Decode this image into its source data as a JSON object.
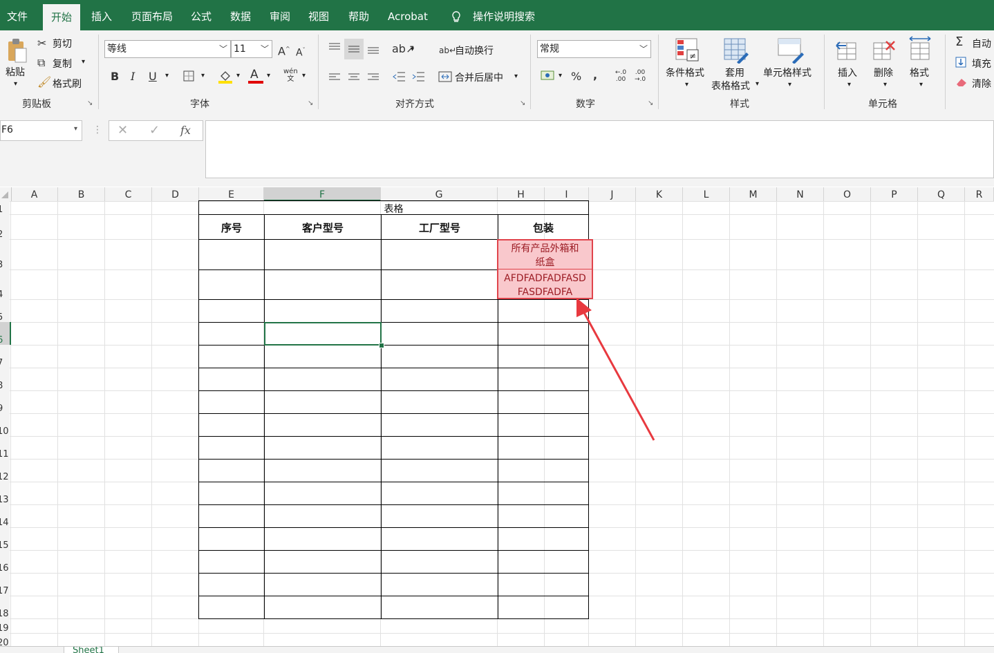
{
  "menu": {
    "tabs": [
      "文件",
      "开始",
      "插入",
      "页面布局",
      "公式",
      "数据",
      "审阅",
      "视图",
      "帮助",
      "Acrobat"
    ],
    "search_label": "操作说明搜索"
  },
  "ribbon": {
    "clipboard": {
      "paste": "粘贴",
      "cut": "剪切",
      "copy": "复制",
      "format_painter": "格式刷",
      "label": "剪贴板"
    },
    "font": {
      "name": "等线",
      "size": "11",
      "bold": "B",
      "italic": "I",
      "underline": "U",
      "label": "字体"
    },
    "alignment": {
      "wrap_text": "自动换行",
      "merge_center": "合并后居中",
      "label": "对齐方式"
    },
    "number": {
      "format": "常规",
      "percent": "%",
      "comma": ",",
      "label": "数字"
    },
    "styles": {
      "conditional": "条件格式",
      "table_format_1": "套用",
      "table_format_2": "表格格式",
      "cell_styles": "单元格样式",
      "label": "样式"
    },
    "cells": {
      "insert": "插入",
      "delete": "删除",
      "format": "格式",
      "label": "单元格"
    },
    "editing": {
      "autosum": "自动",
      "fill": "填充",
      "clear": "清除"
    }
  },
  "formula_bar": {
    "name_box": "F6",
    "fx": "fx",
    "content": ""
  },
  "grid": {
    "columns": [
      "A",
      "B",
      "C",
      "D",
      "E",
      "F",
      "G",
      "H",
      "I",
      "J",
      "K",
      "L",
      "M",
      "N",
      "O",
      "P",
      "Q",
      "R"
    ],
    "rows": [
      "1",
      "2",
      "3",
      "4",
      "5",
      "6",
      "7",
      "8",
      "9",
      "10",
      "11",
      "12",
      "13",
      "14",
      "15",
      "16",
      "17",
      "18",
      "19",
      "20"
    ]
  },
  "table": {
    "title": "表格",
    "headers": [
      "序号",
      "客户型号",
      "工厂型号",
      "包装"
    ],
    "h3_line1": "所有产品外箱和",
    "h3_line2": "纸盒",
    "h4_line1": "AFDFADFADFASD",
    "h4_line2": "FASDFADFA"
  },
  "sheet_tab": "Sheet1",
  "colors": {
    "excel_green": "#217346",
    "highlight_fill": "#f9c8cc",
    "highlight_border": "#e0444c",
    "highlight_text": "#9c1c24"
  }
}
